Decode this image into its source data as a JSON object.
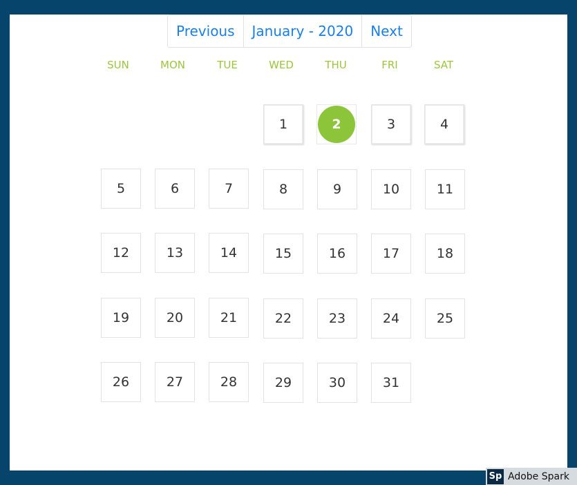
{
  "header": {
    "previous_label": "Previous",
    "month_year": "January - 2020",
    "next_label": "Next"
  },
  "weekdays": [
    "SUN",
    "MON",
    "TUE",
    "WED",
    "THU",
    "FRI",
    "SAT"
  ],
  "days": [
    "1",
    "2",
    "3",
    "4",
    "5",
    "6",
    "7",
    "8",
    "9",
    "10",
    "11",
    "12",
    "13",
    "14",
    "15",
    "16",
    "17",
    "18",
    "19",
    "20",
    "21",
    "22",
    "23",
    "24",
    "25",
    "26",
    "27",
    "28",
    "29",
    "30",
    "31"
  ],
  "selected_day": "2",
  "watermark": {
    "logo": "Sp",
    "text": "Adobe Spark"
  },
  "colors": {
    "frame": "#06446b",
    "accent_green": "#8cc43a",
    "link_blue": "#1a7fe6"
  }
}
